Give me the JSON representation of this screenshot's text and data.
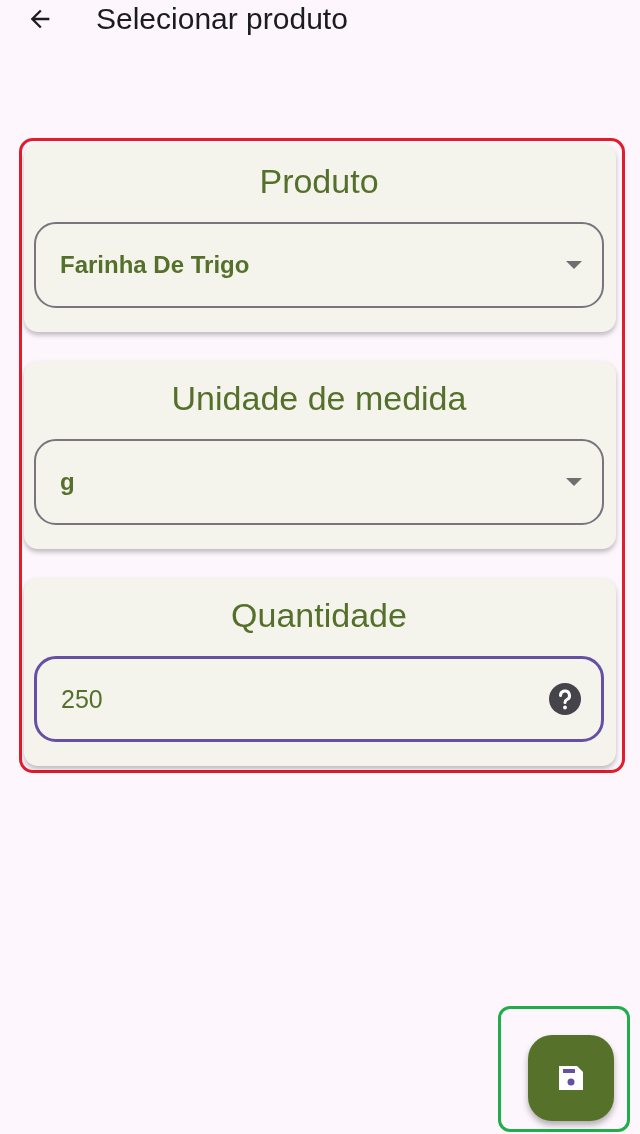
{
  "app_bar": {
    "title": "Selecionar produto"
  },
  "form_frame": {
    "color": "#e21c2a"
  },
  "sections": [
    {
      "kind": "dropdown",
      "title": "Produto",
      "value": "Farinha De Trigo",
      "focused": false
    },
    {
      "kind": "dropdown",
      "title": "Unidade de medida",
      "value": "g",
      "focused": false
    },
    {
      "kind": "input",
      "title": "Quantidade",
      "value": "250",
      "focused": true
    }
  ],
  "fab_frame": {
    "color": "#1fae4a"
  }
}
